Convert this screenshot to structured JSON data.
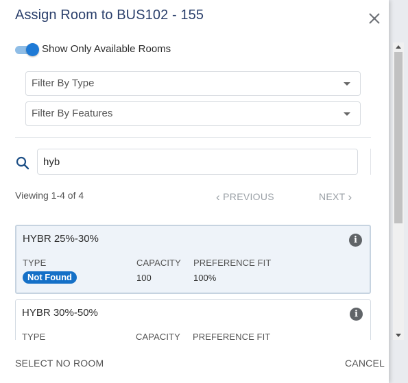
{
  "dialog": {
    "title": "Assign Room to BUS102 - 155"
  },
  "filters": {
    "toggle_label": "Show Only Available Rooms",
    "toggle_on": true,
    "type_placeholder": "Filter By Type",
    "features_placeholder": "Filter By Features"
  },
  "search": {
    "value": "hyb",
    "icon": "search-icon"
  },
  "pagination": {
    "viewing": "Viewing 1-4 of 4",
    "previous": "PREVIOUS",
    "next": "NEXT"
  },
  "rooms": [
    {
      "name": "HYBR 25%-30%",
      "type_label": "TYPE",
      "type_value": "Not Found",
      "capacity_label": "CAPACITY",
      "capacity_value": "100",
      "fit_label": "PREFERENCE FIT",
      "fit_value": "100%"
    },
    {
      "name": "HYBR 30%-50%",
      "type_label": "TYPE",
      "capacity_label": "CAPACITY",
      "fit_label": "PREFERENCE FIT"
    }
  ],
  "footer": {
    "select_no_room": "SELECT NO ROOM",
    "cancel": "CANCEL"
  },
  "colors": {
    "title": "#2a3f6b",
    "accent": "#1570c7",
    "toggle_track": "#8fbde6",
    "selected_card": "#eef3f9"
  }
}
